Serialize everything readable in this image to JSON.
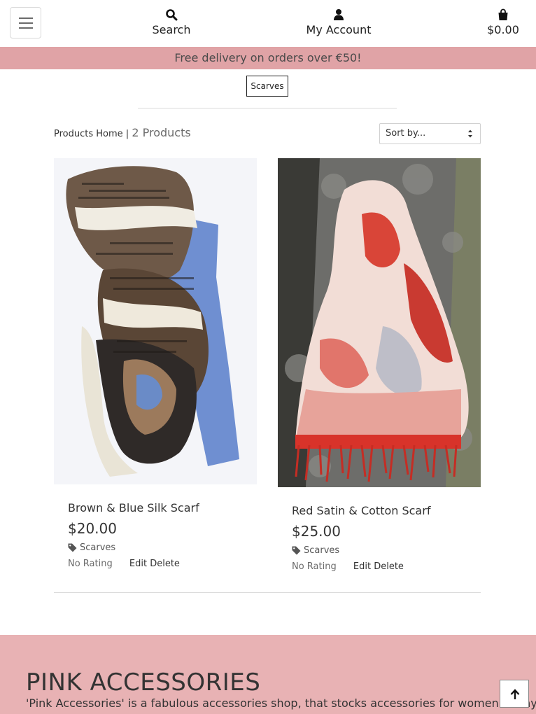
{
  "nav": {
    "menu_icon": "hamburger-menu-icon",
    "search_label": "Search",
    "search_icon": "search-icon",
    "account_label": "My Account",
    "account_icon": "user-icon",
    "bag_total": "$0.00",
    "bag_icon": "shopping-bag-icon"
  },
  "banner": {
    "text": "Free delivery on orders over €50!",
    "color": "#e0a3a6"
  },
  "category_tag": "Scarves",
  "results": {
    "home_link": "Products Home",
    "separator": "|",
    "count": "2 Products"
  },
  "sort": {
    "selected": "Sort by..."
  },
  "products": [
    {
      "name": "Brown & Blue Silk Scarf",
      "price": "$20.00",
      "category": "Scarves",
      "category_icon": "tag-icon",
      "rating": "No Rating",
      "edit": "Edit",
      "delete": "Delete"
    },
    {
      "name": "Red Satin & Cotton Scarf",
      "price": "$25.00",
      "category": "Scarves",
      "category_icon": "tag-icon",
      "rating": "No Rating",
      "edit": "Edit",
      "delete": "Delete"
    }
  ],
  "footer": {
    "title": "PINK ACCESSORIES",
    "text": "'Pink Accessories' is a fabulous accessories shop, that stocks accessories for women of any age,",
    "color": "#e8b2b4"
  },
  "back_to_top_icon": "arrow-up-icon"
}
